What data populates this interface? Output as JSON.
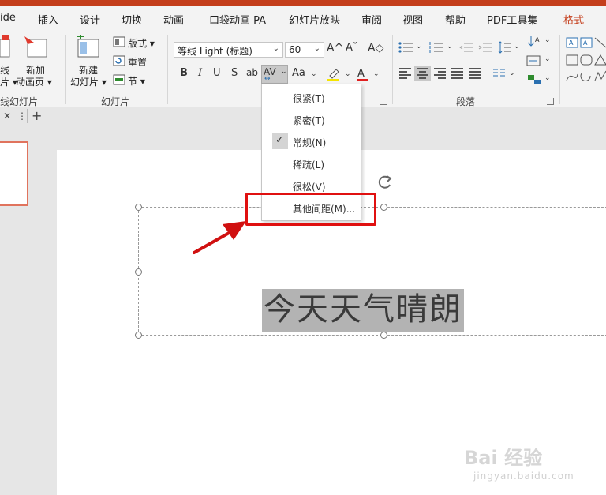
{
  "menu": {
    "tabs": [
      {
        "label": "ide"
      },
      {
        "label": "插入"
      },
      {
        "label": "设计"
      },
      {
        "label": "切换"
      },
      {
        "label": "动画"
      },
      {
        "label": "口袋动画 PA"
      },
      {
        "label": "幻灯片放映"
      },
      {
        "label": "审阅"
      },
      {
        "label": "视图"
      },
      {
        "label": "帮助"
      },
      {
        "label": "PDF工具集"
      },
      {
        "label": "格式"
      }
    ],
    "active_color": "#c43e1c"
  },
  "ribbon": {
    "left_partial": {
      "line1": "线",
      "line2": "片 ▾",
      "group_label": "线幻灯片"
    },
    "new_anim_page": {
      "line1": "新加",
      "line2": "动画页 ▾"
    },
    "new_slide": {
      "line1": "新建",
      "line2": "幻灯片 ▾"
    },
    "layout_label": "版式 ▾",
    "reset_label": "重置",
    "section_label": "节 ▾",
    "slides_group_label": "幻灯片",
    "font_name": "等线 Light (标题)",
    "font_size": "60",
    "bold": "B",
    "italic": "I",
    "underline": "U",
    "shadow": "S",
    "strike": "ab",
    "spacing_button": "AV",
    "change_case": "Aa",
    "paragraph_group_label": "段落"
  },
  "dropdown": {
    "items": [
      {
        "label": "很紧(T)"
      },
      {
        "label": "紧密(T)"
      },
      {
        "label": "常规(N)"
      },
      {
        "label": "稀疏(L)"
      },
      {
        "label": "很松(V)"
      },
      {
        "label": "其他间距(M)..."
      }
    ],
    "checked_index": 2
  },
  "tabstrip": {
    "close": "✕",
    "more": "⋮",
    "add": "+"
  },
  "slide": {
    "text": "今天天气晴朗"
  },
  "watermark": {
    "brand": "Bai 经验",
    "url": "jingyan.baidu.com"
  },
  "colors": {
    "accent": "#c43e1c",
    "highlight_red": "#e01010",
    "selection_gray": "#b3b3b3"
  }
}
